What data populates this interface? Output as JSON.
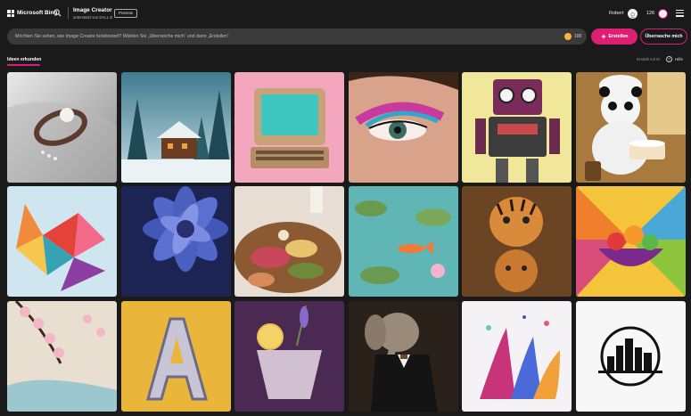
{
  "header": {
    "brand": "Microsoft Bing",
    "product_title": "Image Creator",
    "product_subtitle": "unterstützt von DALL·E",
    "preview_badge": "Preview",
    "user_name": "Robert",
    "coins": "126"
  },
  "prompt": {
    "placeholder": "Möchten Sie sehen, wie Image Creator funktioniert? Wählen Sie „Überrasche mich“ und dann „Erstellen“",
    "boost_count": "100",
    "create_label": "Erstellen",
    "surprise_label": "Überrasche mich"
  },
  "tabs": {
    "explore": "Ideen erkunden",
    "made_with_ai": "Erstellt mit KI",
    "help": "Hilfe"
  },
  "tiles": [
    {
      "name": "ring-pearl-tile"
    },
    {
      "name": "snowy-cabin-tile"
    },
    {
      "name": "retro-computer-tile"
    },
    {
      "name": "eye-makeup-tile"
    },
    {
      "name": "retro-robot-tile"
    },
    {
      "name": "panda-baker-tile"
    },
    {
      "name": "paper-fox-tile"
    },
    {
      "name": "blue-dahlia-tile"
    },
    {
      "name": "charcuterie-board-tile"
    },
    {
      "name": "koi-pond-tile"
    },
    {
      "name": "tiger-figures-tile"
    },
    {
      "name": "fruit-bowl-tile"
    },
    {
      "name": "cherry-blossom-tile"
    },
    {
      "name": "chrome-letter-tile"
    },
    {
      "name": "lavender-cocktail-tile"
    },
    {
      "name": "elephant-suit-tile"
    },
    {
      "name": "paint-splash-tile"
    },
    {
      "name": "city-skyline-logo-tile"
    }
  ],
  "tile_mark": "b",
  "colors": {
    "accent": "#dd1f74",
    "background": "#1b1a1a",
    "prompt_bg": "#3a3a3a"
  }
}
